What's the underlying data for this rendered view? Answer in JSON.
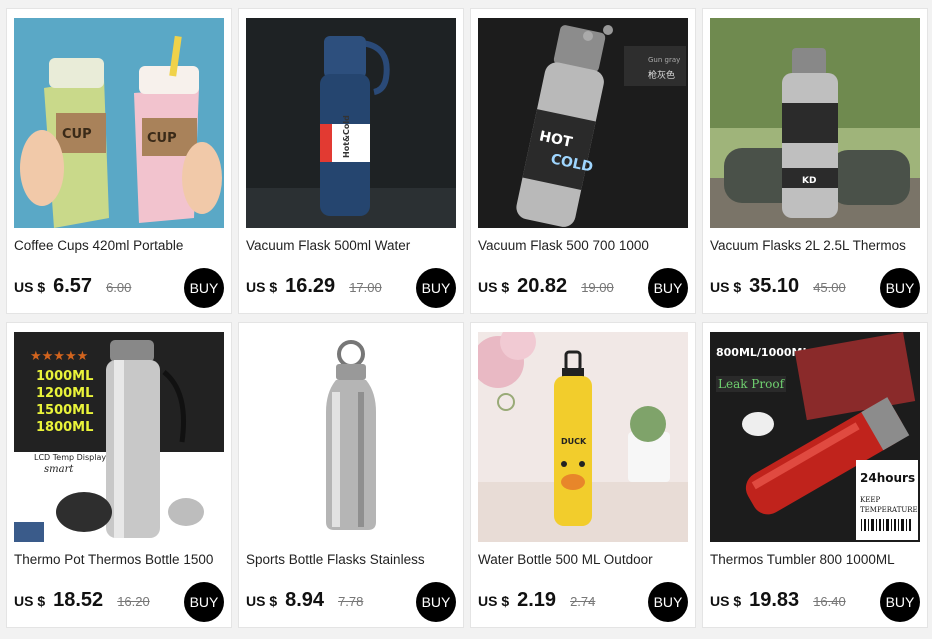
{
  "products": [
    {
      "title": "Coffee Cups 420ml Portable",
      "currency": "US $",
      "price": "6.57",
      "old_price": "6.00",
      "buy_label": "BUY",
      "image": {
        "subject": "green and pink coffee cups",
        "overlay": [
          "CUP",
          "CUP"
        ]
      }
    },
    {
      "title": "Vacuum Flask 500ml Water",
      "currency": "US $",
      "price": "16.29",
      "old_price": "17.00",
      "buy_label": "BUY",
      "image": {
        "subject": "navy vacuum flask",
        "overlay": [
          "Hot&Cold"
        ]
      }
    },
    {
      "title": "Vacuum Flask 500 700 1000",
      "currency": "US $",
      "price": "20.82",
      "old_price": "19.00",
      "buy_label": "BUY",
      "image": {
        "subject": "steel vacuum flask",
        "overlay": [
          "HOT",
          "COLD",
          "枪灰色",
          "Gun gray"
        ]
      }
    },
    {
      "title": "Vacuum Flasks 2L 2.5L Thermos",
      "currency": "US $",
      "price": "35.10",
      "old_price": "45.00",
      "buy_label": "BUY",
      "image": {
        "subject": "large steel thermos outdoors",
        "overlay": [
          "KD"
        ]
      }
    },
    {
      "title": "Thermo Pot Thermos Bottle 1500",
      "currency": "US $",
      "price": "18.52",
      "old_price": "16.20",
      "buy_label": "BUY",
      "image": {
        "subject": "steel thermos with sizes",
        "overlay": [
          "1000ML",
          "1200ML",
          "1500ML",
          "1800ML",
          "LCD Temp Display",
          "smart"
        ]
      }
    },
    {
      "title": "Sports Bottle Flasks Stainless",
      "currency": "US $",
      "price": "8.94",
      "old_price": "7.78",
      "buy_label": "BUY",
      "image": {
        "subject": "stainless sports bottle",
        "overlay": []
      }
    },
    {
      "title": "Water Bottle 500 ML Outdoor",
      "currency": "US $",
      "price": "2.19",
      "old_price": "2.74",
      "buy_label": "BUY",
      "image": {
        "subject": "yellow duck water bottle",
        "overlay": [
          "DUCK"
        ]
      }
    },
    {
      "title": "Thermos Tumbler 800 1000ML",
      "currency": "US $",
      "price": "19.83",
      "old_price": "16.40",
      "buy_label": "BUY",
      "image": {
        "subject": "red thermos tumbler",
        "overlay": [
          "800ML/1000ML",
          "Leak Proof",
          "24hours",
          "KEEP",
          "TEMPERATURE"
        ]
      }
    }
  ],
  "colors": {
    "page_bg": "#f2f2f2",
    "card_bg": "#ffffff",
    "buy_bg": "#000000",
    "buy_text": "#ffffff",
    "price_text": "#111111",
    "old_price_text": "#777777"
  }
}
